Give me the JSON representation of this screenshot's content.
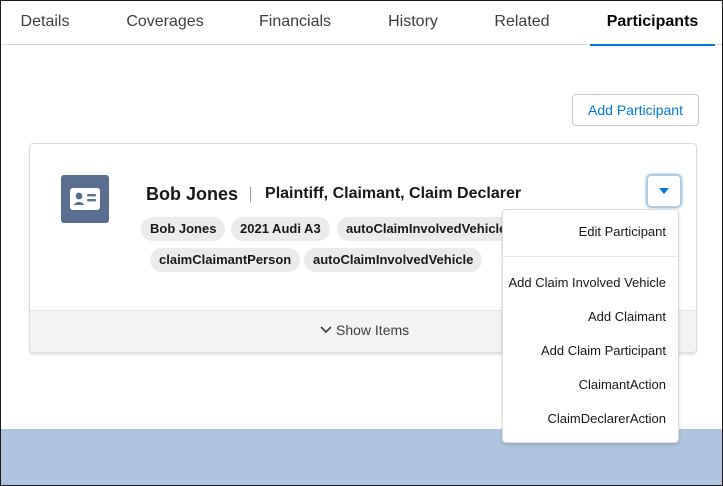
{
  "tabs": [
    {
      "label": "Details"
    },
    {
      "label": "Coverages"
    },
    {
      "label": "Financials"
    },
    {
      "label": "History"
    },
    {
      "label": "Related"
    },
    {
      "label": "Participants",
      "active": true
    }
  ],
  "add_participant_label": "Add Participant",
  "participant": {
    "name": "Bob Jones",
    "roles": "Plaintiff, Claimant, Claim Declarer",
    "chips": [
      "Bob Jones",
      "2021 Audi A3",
      "autoClaimInvolvedVehicle",
      "claimClaimantPerson",
      "autoClaimInvolvedVehicle"
    ],
    "avatar_icon": "contact-card-icon"
  },
  "show_items_label": "Show Items",
  "menu": {
    "items": [
      "Edit Participant",
      "Add Claim Involved Vehicle",
      "Add Claimant",
      "Add Claim Participant",
      "ClaimantAction",
      "ClaimDeclarerAction"
    ]
  },
  "colors": {
    "accent": "#0176d3",
    "avatar": "#5a6f8f",
    "band": "#b0c4df",
    "chip": "#ecebea"
  }
}
